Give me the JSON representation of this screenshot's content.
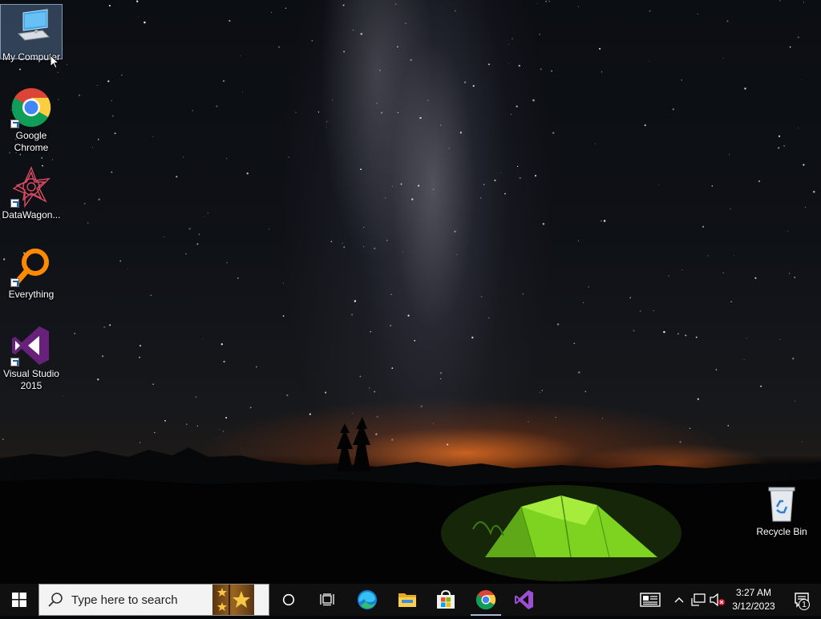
{
  "desktop": {
    "icons": [
      {
        "label": "My Computer",
        "icon": "computer-icon",
        "selected": true
      },
      {
        "label": "Google Chrome",
        "icon": "chrome-icon",
        "shortcut": true
      },
      {
        "label": "DataWagon...",
        "icon": "datawagon-icon",
        "shortcut": true
      },
      {
        "label": "Everything",
        "icon": "everything-search-icon",
        "shortcut": true
      },
      {
        "label": "Visual Studio 2015",
        "icon": "visual-studio-icon",
        "shortcut": true
      }
    ],
    "recycle_bin": {
      "label": "Recycle Bin",
      "icon": "recycle-bin-icon"
    }
  },
  "taskbar": {
    "start_icon": "windows-logo-icon",
    "search": {
      "placeholder": "Type here to search"
    },
    "cortana_icon": "cortana-circle-icon",
    "task_view_icon": "task-view-icon",
    "pinned_apps": [
      {
        "name": "Microsoft Edge",
        "icon": "edge-icon",
        "active": false
      },
      {
        "name": "File Explorer",
        "icon": "folder-icon",
        "active": false
      },
      {
        "name": "Microsoft Store",
        "icon": "store-icon",
        "active": false
      },
      {
        "name": "Google Chrome",
        "icon": "chrome-icon",
        "active": true
      },
      {
        "name": "Visual Studio",
        "icon": "visual-studio-icon",
        "active": false
      }
    ],
    "tray": {
      "icons": [
        "news-icon",
        "chevron-up-icon",
        "network-icon",
        "volume-muted-icon"
      ],
      "time": "3:27 AM",
      "date": "3/12/2023",
      "notification_count": "1"
    }
  },
  "colors": {
    "taskbar": "#101010",
    "tent_green": "#7ed321",
    "horizon_glow": "#e86e1e"
  }
}
